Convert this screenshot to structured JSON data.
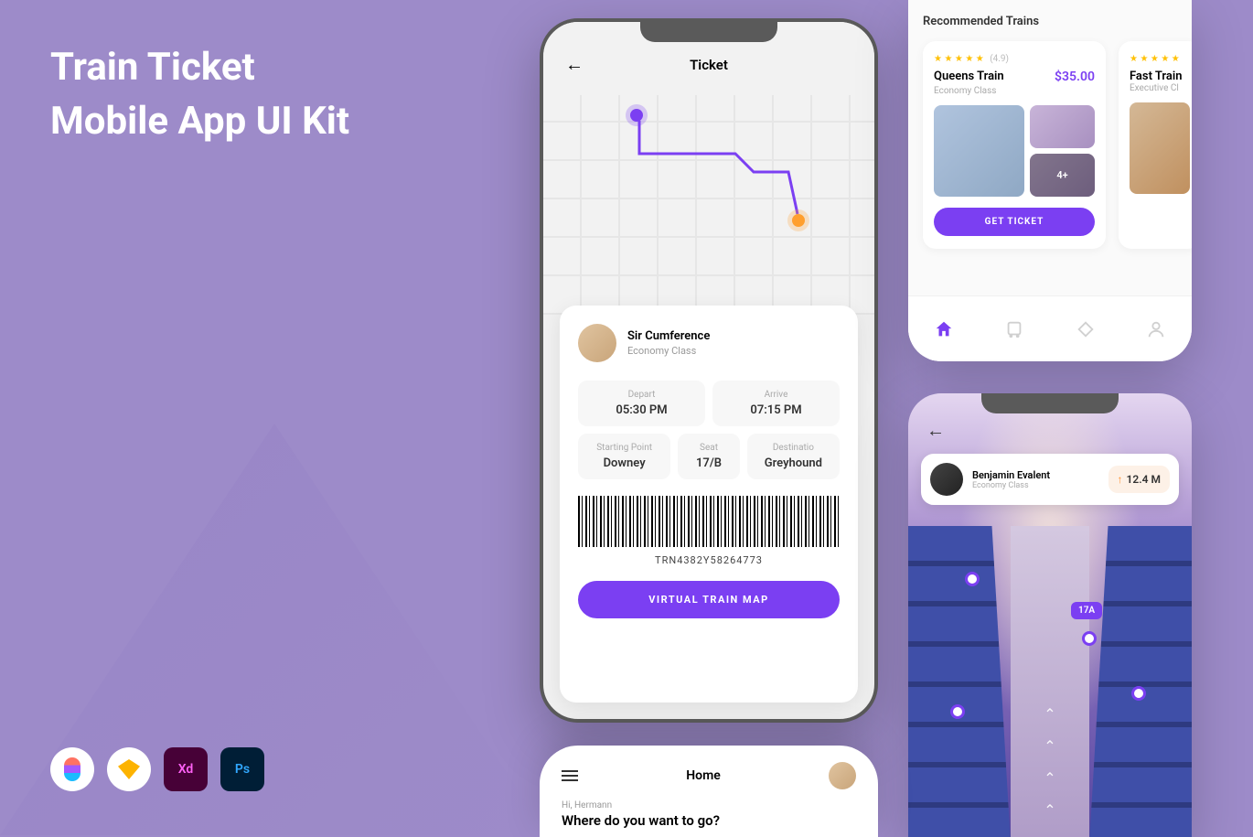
{
  "title": {
    "line1": "Train Ticket",
    "line2": "Mobile App UI Kit"
  },
  "tools": [
    "Figma",
    "Sketch",
    "Xd",
    "Ps"
  ],
  "ticket_screen": {
    "header": "Ticket",
    "passenger": {
      "name": "Sir Cumference",
      "class": "Economy Class"
    },
    "depart": {
      "label": "Depart",
      "value": "05:30 PM"
    },
    "arrive": {
      "label": "Arrive",
      "value": "07:15 PM"
    },
    "start": {
      "label": "Starting Point",
      "value": "Downey"
    },
    "seat": {
      "label": "Seat",
      "value": "17/B"
    },
    "destination": {
      "label": "Destinatio",
      "value": "Greyhound"
    },
    "barcode_number": "TRN4382Y58264773",
    "button": "VIRTUAL TRAIN MAP"
  },
  "recommend": {
    "title": "Recommended Trains",
    "cards": [
      {
        "rating": "(4.9)",
        "name": "Queens Train",
        "price": "$35.00",
        "class": "Economy Class",
        "more": "4+",
        "button": "GET TICKET"
      },
      {
        "rating": "",
        "name": "Fast Train",
        "price": "",
        "class": "Executive Cl"
      }
    ]
  },
  "seat_map": {
    "passenger": {
      "name": "Benjamin Evalent",
      "class": "Economy Class"
    },
    "distance": "12.4 M",
    "selected_seat": "17A"
  },
  "home": {
    "title": "Home",
    "greeting": "Hi, Hermann",
    "question": "Where do you want to go?"
  }
}
